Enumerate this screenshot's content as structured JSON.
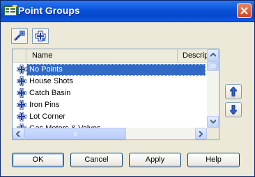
{
  "window": {
    "title": "Point Groups",
    "app_icon": "point-groups-app-icon",
    "close_icon": "close-icon"
  },
  "toolbar": {
    "buttons": [
      {
        "icon": "point-group-properties-icon"
      },
      {
        "icon": "new-point-group-icon"
      }
    ]
  },
  "list": {
    "columns": [
      "Name",
      "Description"
    ],
    "row_icon": "point-group-icon",
    "items": [
      {
        "label": "No Points",
        "selected": true
      },
      {
        "label": "House Shots",
        "selected": false
      },
      {
        "label": "Catch Basin",
        "selected": false
      },
      {
        "label": "Iron Pins",
        "selected": false
      },
      {
        "label": "Lot Corner",
        "selected": false
      },
      {
        "label": "Gas Meters & Valves",
        "selected": false
      }
    ]
  },
  "move_buttons": {
    "up_icon": "arrow-up-icon",
    "down_icon": "arrow-down-icon"
  },
  "buttons": {
    "ok": "OK",
    "cancel": "Cancel",
    "apply": "Apply",
    "help": "Help"
  }
}
